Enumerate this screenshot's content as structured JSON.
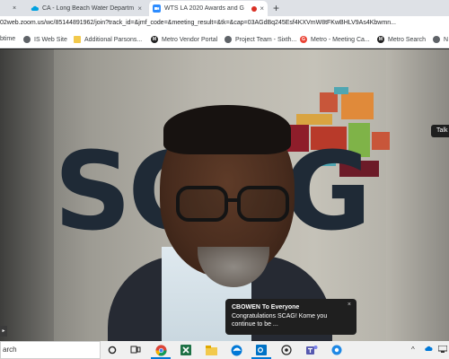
{
  "tabs": [
    {
      "title": "CA - Long Beach Water Departm",
      "icon": "cloud-icon",
      "color": "#00a1e0",
      "active": false
    },
    {
      "title": "WTS LA 2020 Awards and G",
      "icon": "zoom-icon",
      "color": "#2d8cff",
      "active": true,
      "recording": true
    }
  ],
  "new_tab_symbol": "+",
  "close_symbol": "×",
  "address": {
    "url": "02web.zoom.us/wc/85144891962/join?track_id=&jmf_code=&meeting_result=&tk=&cap=03AGdBq245Esf4KXVmW8tFKwBHLV9As4Kbwmn..."
  },
  "bookmarks": [
    {
      "label": "btime",
      "icon": "none"
    },
    {
      "label": "IS Web Site",
      "icon": "globe-icon"
    },
    {
      "label": "Additional Parsons...",
      "icon": "folder-icon"
    },
    {
      "label": "Metro Vendor Portal",
      "icon": "metro-icon"
    },
    {
      "label": "Project Team - Sixth...",
      "icon": "globe-icon"
    },
    {
      "label": "Metro - Meeting Ca...",
      "icon": "google-icon"
    },
    {
      "label": "Metro Search",
      "icon": "metro-icon"
    },
    {
      "label": "N",
      "icon": "globe-icon"
    }
  ],
  "video": {
    "participant_chip": "Talk",
    "background_text": "SCAG"
  },
  "chat": {
    "sender": "CBOWEN To Everyone",
    "message": "Congratulations SCAG! Kome you continue to be ..."
  },
  "taskbar": {
    "search_text": "arch"
  },
  "colors": {
    "tab_strip": "#dee1e6",
    "chat_bg": "#1f1f1f",
    "taskbar": "#f0f0f0",
    "record_red": "#d93025"
  }
}
